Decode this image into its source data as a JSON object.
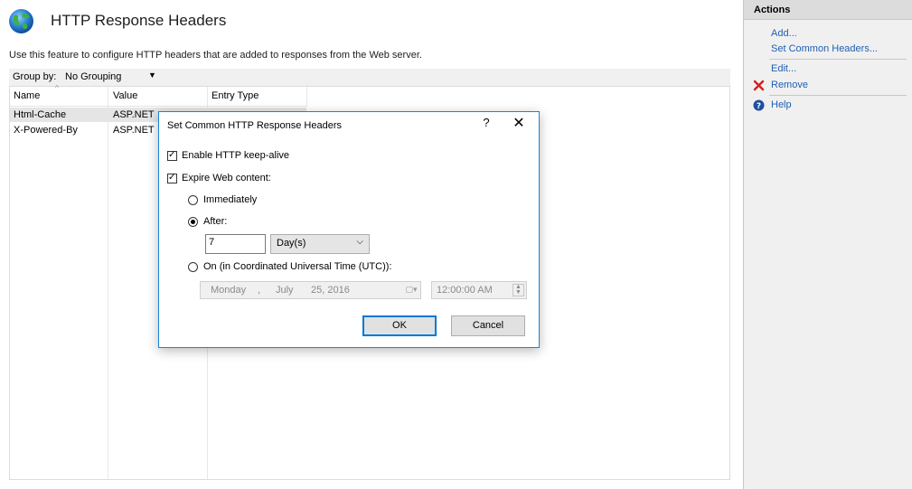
{
  "page": {
    "title": "HTTP Response Headers",
    "description": "Use this feature to configure HTTP headers that are added to responses from the Web server."
  },
  "group_bar": {
    "label": "Group by:",
    "value": "No Grouping"
  },
  "list": {
    "columns": [
      "Name",
      "Value",
      "Entry Type"
    ],
    "rows": [
      {
        "name": "Html-Cache",
        "value": "ASP.NET",
        "selected": true
      },
      {
        "name": "X-Powered-By",
        "value": "ASP.NET",
        "selected": false
      }
    ]
  },
  "actions": {
    "title": "Actions",
    "add": "Add...",
    "set_common": "Set Common Headers...",
    "edit": "Edit...",
    "remove": "Remove",
    "help": "Help"
  },
  "dialog": {
    "title": "Set Common HTTP Response Headers",
    "help_glyph": "?",
    "close_glyph": "✕",
    "keep_alive_label": "Enable HTTP keep-alive",
    "keep_alive_checked": true,
    "expire_label": "Expire Web content:",
    "expire_checked": true,
    "immediately_label": "Immediately",
    "after_label": "After:",
    "after_value": "7",
    "after_unit": "Day(s)",
    "on_label": "On (in Coordinated Universal Time (UTC)):",
    "selected_option": "after",
    "date": {
      "weekday": "Monday",
      "sep": ",",
      "month": "July",
      "day_year": "25, 2016"
    },
    "time": "12:00:00 AM",
    "ok_label": "OK",
    "cancel_label": "Cancel"
  },
  "colors": {
    "link": "#1e5fb4",
    "dialog_border": "#1883d7",
    "remove_icon": "#d42020",
    "help_icon": "#1e4fa0",
    "selection": "#e5e5e5"
  }
}
